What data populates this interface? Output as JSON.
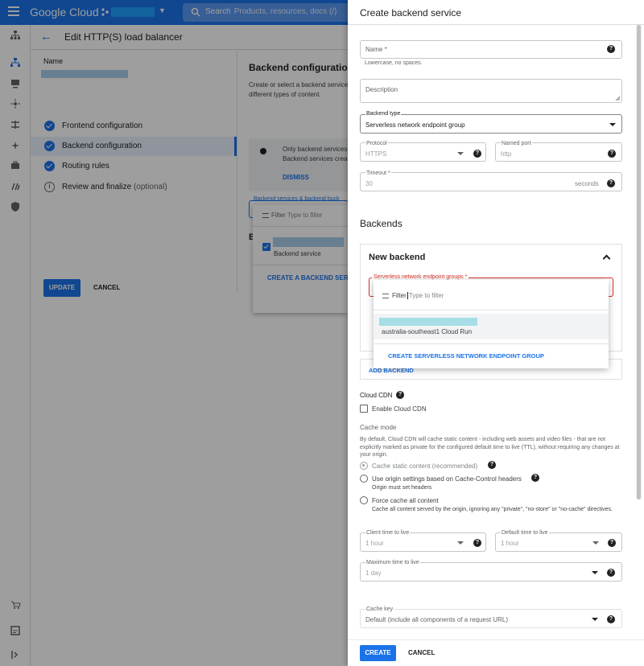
{
  "topbar": {
    "brand": "Google Cloud",
    "search_label": "Search",
    "search_placeholder": "Products, resources, docs (/)"
  },
  "page": {
    "title": "Edit HTTP(S) load balancer",
    "name_label": "Name"
  },
  "steps": [
    {
      "label": "Frontend configuration",
      "optional": ""
    },
    {
      "label": "Backend configuration",
      "optional": ""
    },
    {
      "label": "Routing rules",
      "optional": ""
    },
    {
      "label": "Review and finalize",
      "optional": "(optional)"
    }
  ],
  "bg_buttons": {
    "update": "UPDATE",
    "cancel": "CANCEL"
  },
  "backend_config": {
    "title": "Backend configuration",
    "desc_line1": "Create or select a backend service",
    "desc_line2": "different types of content.",
    "info_line1": "Only backend services",
    "info_line2": "Backend services crea",
    "dismiss": "DISMISS",
    "select_label": "Backend services & backend buck",
    "b_heading": "B"
  },
  "bs_dropdown": {
    "filter_label": "Filter",
    "filter_placeholder": "Type to filter",
    "item_label": "Backend service",
    "create": "CREATE A BACKEND SERV"
  },
  "panel": {
    "title": "Create backend service",
    "name": {
      "label": "Name *",
      "hint": "Lowercase, no spaces."
    },
    "description": {
      "label": "Description"
    },
    "backend_type": {
      "label": "Backend type",
      "value": "Serverless network endpoint group"
    },
    "protocol": {
      "label": "Protocol",
      "value": "HTTPS"
    },
    "named_port": {
      "label": "Named port",
      "value": "http"
    },
    "timeout": {
      "label": "Timeout *",
      "value": "30",
      "unit": "seconds"
    },
    "backends_title": "Backends",
    "new_backend": {
      "title": "New backend",
      "neg_label": "Serverless network endpoint groups *"
    },
    "neg_dropdown": {
      "filter_label": "Filter",
      "filter_placeholder": "Type to filter",
      "item_label": "australia-southeast1 Cloud Run",
      "create": "CREATE SERVERLESS NETWORK ENDPOINT GROUP"
    },
    "add_backend": "ADD BACKEND",
    "cloud_cdn": {
      "title": "Cloud CDN",
      "enable": "Enable Cloud CDN"
    },
    "cache_mode": {
      "title": "Cache mode",
      "description": "By default, Cloud CDN will cache static content - including web assets and video files - that are not explicitly marked as private for the configured default time to live (TTL), without requiring any changes at your origin.",
      "options": [
        {
          "label": "Cache static content (recommended)",
          "sub": ""
        },
        {
          "label": "Use origin settings based on Cache-Control headers",
          "sub": "Origin must set headers"
        },
        {
          "label": "Force cache all content",
          "sub": "Cache all content served by the origin, ignoring any \"private\", \"no-store\" or \"no-cache\" directives."
        }
      ]
    },
    "client_ttl": {
      "label": "Client time to live",
      "value": "1 hour"
    },
    "default_ttl": {
      "label": "Default time to live",
      "value": "1 hour"
    },
    "max_ttl": {
      "label": "Maximum time to live",
      "value": "1 day"
    },
    "cache_key": {
      "label": "Cache key",
      "value": "Default (include all components of a request URL)"
    },
    "buttons": {
      "create": "CREATE",
      "cancel": "CANCEL"
    }
  },
  "colors": {
    "accent": "#1a73e8",
    "error": "#d93025",
    "scrim": "rgba(0,0,0,0.38)"
  }
}
